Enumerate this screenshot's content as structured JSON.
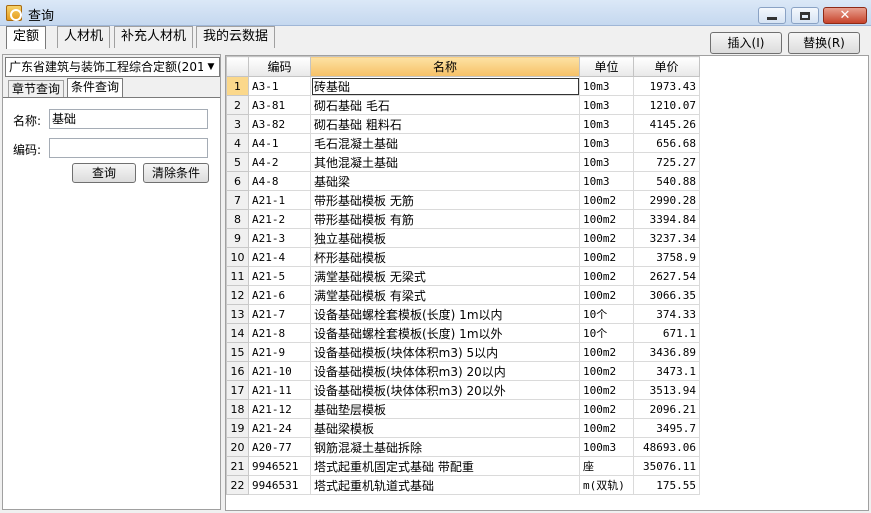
{
  "window": {
    "title": "查询"
  },
  "top_tabs": [
    {
      "label": "定额",
      "active": true
    },
    {
      "label": "人材机",
      "active": false
    },
    {
      "label": "补充人材机",
      "active": false
    },
    {
      "label": "我的云数据",
      "active": false
    }
  ],
  "toolbar": {
    "insert_label": "插入(I)",
    "replace_label": "替换(R)"
  },
  "left": {
    "library": "广东省建筑与装饰工程综合定额(201",
    "sub_tabs": [
      {
        "label": "章节查询"
      },
      {
        "label": "条件查询"
      }
    ],
    "name_label": "名称:",
    "name_value": "基础",
    "code_label": "编码:",
    "code_value": "",
    "query_button": "查询",
    "clear_button": "清除条件"
  },
  "table": {
    "headers": [
      "",
      "编码",
      "名称",
      "单位",
      "单价"
    ],
    "rows": [
      {
        "n": "1",
        "code": "A3-1",
        "name": "砖基础",
        "unit": "10m3",
        "price": "1973.43"
      },
      {
        "n": "2",
        "code": "A3-81",
        "name": "砌石基础 毛石",
        "unit": "10m3",
        "price": "1210.07"
      },
      {
        "n": "3",
        "code": "A3-82",
        "name": "砌石基础 粗料石",
        "unit": "10m3",
        "price": "4145.26"
      },
      {
        "n": "4",
        "code": "A4-1",
        "name": "毛石混凝土基础",
        "unit": "10m3",
        "price": "656.68"
      },
      {
        "n": "5",
        "code": "A4-2",
        "name": "其他混凝土基础",
        "unit": "10m3",
        "price": "725.27"
      },
      {
        "n": "6",
        "code": "A4-8",
        "name": "基础梁",
        "unit": "10m3",
        "price": "540.88"
      },
      {
        "n": "7",
        "code": "A21-1",
        "name": "带形基础模板 无筋",
        "unit": "100m2",
        "price": "2990.28"
      },
      {
        "n": "8",
        "code": "A21-2",
        "name": "带形基础模板 有筋",
        "unit": "100m2",
        "price": "3394.84"
      },
      {
        "n": "9",
        "code": "A21-3",
        "name": "独立基础模板",
        "unit": "100m2",
        "price": "3237.34"
      },
      {
        "n": "10",
        "code": "A21-4",
        "name": "杯形基础模板",
        "unit": "100m2",
        "price": "3758.9"
      },
      {
        "n": "11",
        "code": "A21-5",
        "name": "满堂基础模板 无梁式",
        "unit": "100m2",
        "price": "2627.54"
      },
      {
        "n": "12",
        "code": "A21-6",
        "name": "满堂基础模板 有梁式",
        "unit": "100m2",
        "price": "3066.35"
      },
      {
        "n": "13",
        "code": "A21-7",
        "name": "设备基础螺栓套模板(长度) 1m以内",
        "unit": "10个",
        "price": "374.33"
      },
      {
        "n": "14",
        "code": "A21-8",
        "name": "设备基础螺栓套模板(长度) 1m以外",
        "unit": "10个",
        "price": "671.1"
      },
      {
        "n": "15",
        "code": "A21-9",
        "name": "设备基础模板(块体体积m3) 5以内",
        "unit": "100m2",
        "price": "3436.89"
      },
      {
        "n": "16",
        "code": "A21-10",
        "name": "设备基础模板(块体体积m3) 20以内",
        "unit": "100m2",
        "price": "3473.1"
      },
      {
        "n": "17",
        "code": "A21-11",
        "name": "设备基础模板(块体体积m3) 20以外",
        "unit": "100m2",
        "price": "3513.94"
      },
      {
        "n": "18",
        "code": "A21-12",
        "name": "基础垫层模板",
        "unit": "100m2",
        "price": "2096.21"
      },
      {
        "n": "19",
        "code": "A21-24",
        "name": "基础梁模板",
        "unit": "100m2",
        "price": "3495.7"
      },
      {
        "n": "20",
        "code": "A20-77",
        "name": "钢筋混凝土基础拆除",
        "unit": "100m3",
        "price": "48693.06"
      },
      {
        "n": "21",
        "code": "9946521",
        "name": "塔式起重机固定式基础 带配重",
        "unit": "座",
        "price": "35076.11"
      },
      {
        "n": "22",
        "code": "9946531",
        "name": "塔式起重机轨道式基础",
        "unit": "m(双轨)",
        "price": "175.55"
      }
    ]
  }
}
